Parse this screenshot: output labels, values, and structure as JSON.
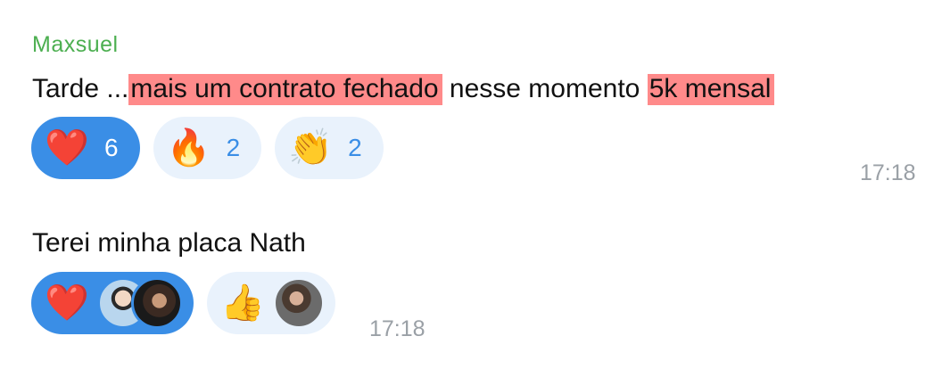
{
  "messages": [
    {
      "sender": "Maxsuel",
      "text_parts": [
        {
          "text": "Tarde ...",
          "highlight": false
        },
        {
          "text": "mais um contrato fechado",
          "highlight": true
        },
        {
          "text": " nesse momento ",
          "highlight": false
        },
        {
          "text": "5k mensal",
          "highlight": true
        }
      ],
      "reactions": [
        {
          "emoji": "❤️",
          "icon": "heart-icon",
          "count": "6",
          "active": true
        },
        {
          "emoji": "🔥",
          "icon": "fire-icon",
          "count": "2",
          "active": false
        },
        {
          "emoji": "👏",
          "icon": "clapping-hands-icon",
          "count": "2",
          "active": false
        }
      ],
      "time": "17:18"
    },
    {
      "text": "Terei minha placa Nath",
      "reactions": [
        {
          "emoji": "❤️",
          "icon": "heart-icon",
          "avatars": 2,
          "active": true
        },
        {
          "emoji": "👍",
          "icon": "thumbs-up-icon",
          "avatars": 1,
          "active": false
        }
      ],
      "time": "17:18"
    }
  ],
  "colors": {
    "sender": "#4caf50",
    "highlight": "#ff8a8a",
    "reaction_active": "#3a8ee6",
    "reaction_passive": "#e9f2fc",
    "timestamp": "#9aa0a6"
  }
}
